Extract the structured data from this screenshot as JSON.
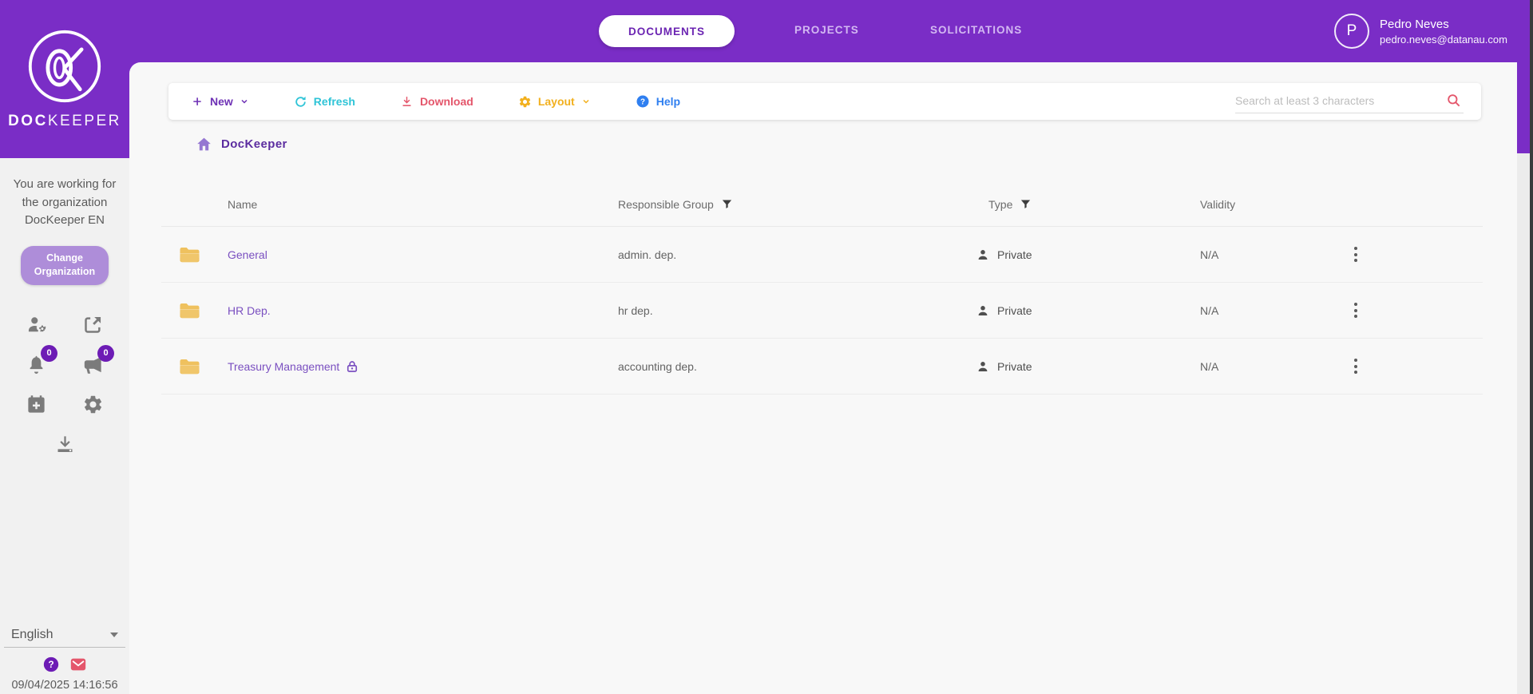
{
  "brand": {
    "bold": "DOC",
    "light": "KEEPER"
  },
  "nav": {
    "tabs": [
      {
        "label": "DOCUMENTS",
        "active": true
      },
      {
        "label": "PROJECTS",
        "active": false
      },
      {
        "label": "SOLICITATIONS",
        "active": false
      }
    ]
  },
  "user": {
    "initial": "P",
    "name": "Pedro Neves",
    "email": "pedro.neves@datanau.com"
  },
  "sidebar": {
    "org_message": "You are working for the organization DocKeeper EN",
    "change_org_label": "Change Organization",
    "badges": {
      "notifications": "0",
      "announcements": "0"
    },
    "language": "English",
    "timestamp": "09/04/2025 14:16:56",
    "icons": [
      "manage-users",
      "share",
      "notifications-bell",
      "announcements-megaphone",
      "calendar-add",
      "settings-gear",
      "download-tray",
      "help-circle",
      "mail"
    ]
  },
  "toolbar": {
    "new_label": "New",
    "refresh_label": "Refresh",
    "download_label": "Download",
    "layout_label": "Layout",
    "help_label": "Help",
    "search_placeholder": "Search at least 3 characters",
    "icons": [
      "plus",
      "refresh",
      "download-arrow",
      "layout-gear",
      "help-circle",
      "search-magnifier"
    ]
  },
  "breadcrumb": {
    "label": "DocKeeper"
  },
  "table": {
    "headers": {
      "name": "Name",
      "group": "Responsible Group",
      "type": "Type",
      "validity": "Validity"
    },
    "rows": [
      {
        "name": "General",
        "group": "admin. dep.",
        "type": "Private",
        "validity": "N/A",
        "locked": false
      },
      {
        "name": "HR Dep.",
        "group": "hr dep.",
        "type": "Private",
        "validity": "N/A",
        "locked": false
      },
      {
        "name": "Treasury Management",
        "group": "accounting dep.",
        "type": "Private",
        "validity": "N/A",
        "locked": true
      }
    ]
  },
  "colors": {
    "primary_purple": "#7a2dc6",
    "button_light_purple": "#ae8dd9",
    "link_purple": "#7a4fc0",
    "refresh_teal": "#2fc4d7",
    "download_red": "#e4566b",
    "layout_amber": "#f2b01e",
    "help_blue": "#2f7ff0",
    "folder_yellow": "#efc15e",
    "badge_purple": "#6d1cb5"
  }
}
